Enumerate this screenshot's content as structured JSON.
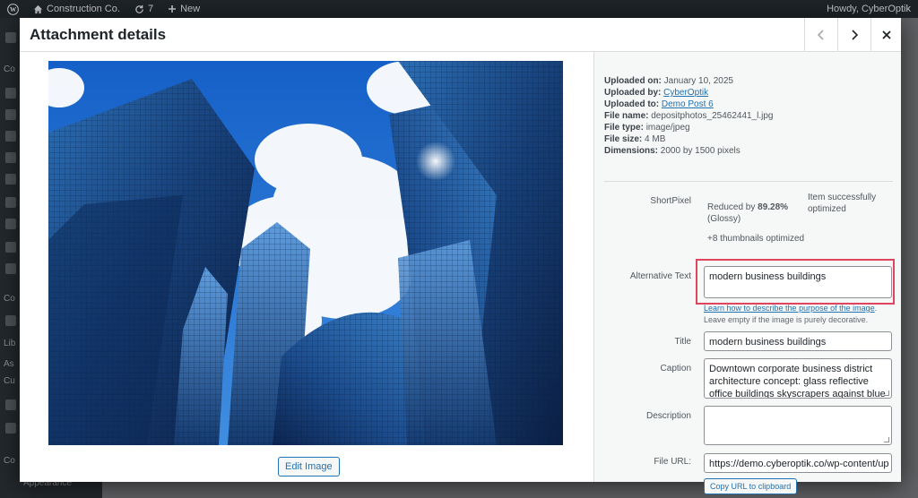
{
  "admin_bar": {
    "site_name": "Construction Co.",
    "updates_count": "7",
    "new_label": "New",
    "howdy": "Howdy, CyberOptik"
  },
  "sidebar_fragments": [
    "Co",
    "Co",
    "Lib",
    "As",
    "Cu",
    "Co",
    "Appearance"
  ],
  "modal": {
    "title": "Attachment details",
    "edit_image_label": "Edit Image"
  },
  "details": {
    "uploaded_on_label": "Uploaded on:",
    "uploaded_on": "January 10, 2025",
    "uploaded_by_label": "Uploaded by:",
    "uploaded_by": "CyberOptik",
    "uploaded_to_label": "Uploaded to:",
    "uploaded_to": "Demo Post 6",
    "file_name_label": "File name:",
    "file_name": "depositphotos_25462441_l.jpg",
    "file_type_label": "File type:",
    "file_type": "image/jpeg",
    "file_size_label": "File size:",
    "file_size": "4 MB",
    "dimensions_label": "Dimensions:",
    "dimensions": "2000 by 1500 pixels"
  },
  "shortpixel": {
    "label": "ShortPixel",
    "reduced_prefix": "Reduced by",
    "reduced_value": "89.28%",
    "mode": "(Glossy)",
    "thumbnails": "+8 thumbnails optimized",
    "status_line1": "Item successfully",
    "status_line2": "optimized"
  },
  "fields": {
    "alt_label": "Alternative Text",
    "alt_value": "modern business buildings",
    "alt_help_link": "Learn how to describe the purpose of the image",
    "alt_help_period": ".",
    "alt_help_text": "Leave empty if the image is purely decorative.",
    "title_label": "Title",
    "title_value": "modern business buildings",
    "caption_label": "Caption",
    "caption_value": "Downtown corporate business district architecture concept: glass reflective office buildings skyscrapers against blue",
    "description_label": "Description",
    "description_value": "",
    "file_url_label": "File URL:",
    "file_url_value": "https://demo.cyberoptik.co/wp-content/up",
    "copy_url_label": "Copy URL to clipboard"
  },
  "colors": {
    "accent": "#2271b1",
    "highlight": "#e0455f",
    "admin_bar": "#1d2327"
  }
}
